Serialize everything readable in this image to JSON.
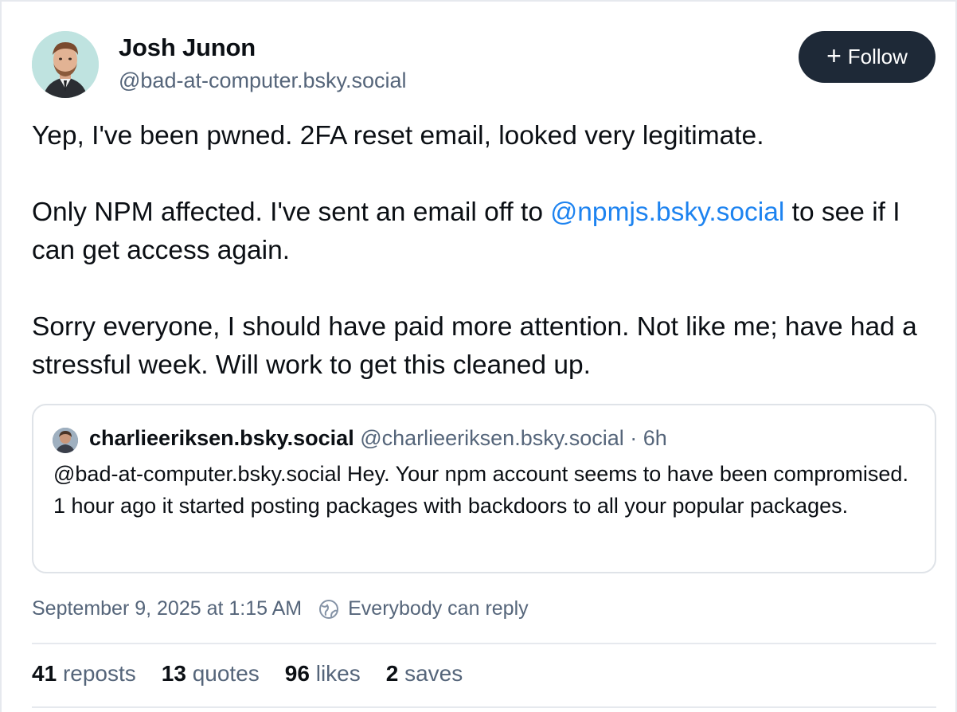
{
  "author": {
    "display_name": "Josh Junon",
    "handle": "@bad-at-computer.bsky.social"
  },
  "follow_button": {
    "icon": "plus-icon",
    "label": "Follow"
  },
  "post": {
    "paragraph1": "Yep, I've been pwned. 2FA reset email, looked very legitimate.",
    "paragraph2_before": "Only NPM affected. I've sent an email off to ",
    "paragraph2_mention": "@npmjs.bsky.social",
    "paragraph2_after": " to see if I can get access again.",
    "paragraph3": "Sorry everyone, I should have paid more attention. Not like me; have had a stressful week. Will work to get this cleaned up."
  },
  "quote": {
    "display_name": "charlieeriksen.bsky.social",
    "meta": " @charlieeriksen.bsky.social · 6h",
    "body": "@bad-at-computer.bsky.social Hey. Your npm account seems to have been compromised. 1 hour ago it started posting packages with backdoors to all your popular packages."
  },
  "meta": {
    "timestamp": "September 9, 2025 at 1:15 AM",
    "reply_icon": "globe-icon",
    "reply_setting": "Everybody can reply"
  },
  "stats": {
    "reposts": {
      "count": "41",
      "label": "reposts"
    },
    "quotes": {
      "count": "13",
      "label": "quotes"
    },
    "likes": {
      "count": "96",
      "label": "likes"
    },
    "saves": {
      "count": "2",
      "label": "saves"
    }
  },
  "colors": {
    "mention": "#1d83f0",
    "follow_bg": "#1e2937",
    "muted_text": "#55657a"
  }
}
